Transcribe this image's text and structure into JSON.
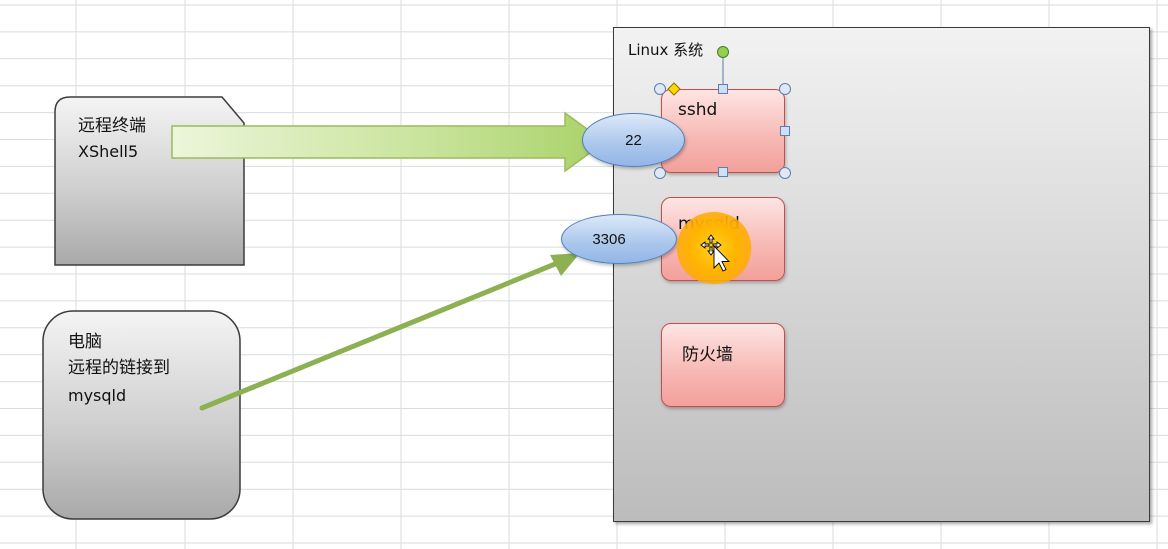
{
  "terminal_box": {
    "line1": "远程终端",
    "line2": "XShell5"
  },
  "computer_box": {
    "line1": "电脑",
    "line2": "远程的链接到",
    "line3": "mysqld"
  },
  "linux_box": {
    "label": "Linux 系统"
  },
  "services": [
    {
      "label": "sshd"
    },
    {
      "label": "mysqld"
    },
    {
      "label": "防火墙"
    }
  ],
  "ports": [
    {
      "label": "22"
    },
    {
      "label": "3306"
    }
  ],
  "colors": {
    "arrow_green": "#9bbb59",
    "service_fill": "#f7b7b3",
    "port_fill": "#aac6ec",
    "linux_fill": "#d4d4d4",
    "cursor_glow": "#ffb300"
  }
}
